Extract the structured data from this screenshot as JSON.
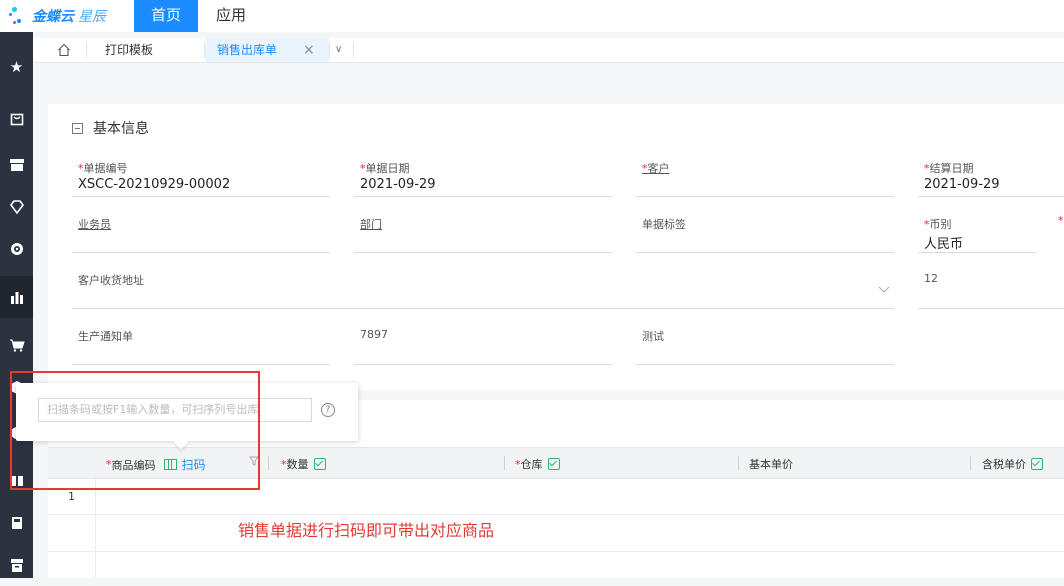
{
  "brand": {
    "name": "金蝶云",
    "suffix": "星辰"
  },
  "nav": {
    "home": "首页",
    "app": "应用"
  },
  "tabs": {
    "home_icon": "home-icon",
    "print": "打印模板",
    "active": "销售出库单",
    "close": "×",
    "more": "∨"
  },
  "section": {
    "title": "基本信息"
  },
  "fields": {
    "bill_no": {
      "label": "单据编号",
      "value": "XSCC-20210929-00002"
    },
    "bill_date": {
      "label": "单据日期",
      "value": "2021-09-29"
    },
    "customer": {
      "label": "客户",
      "value": ""
    },
    "settle_date": {
      "label": "结算日期",
      "value": "2021-09-29"
    },
    "salesman": {
      "label": "业务员"
    },
    "dept": {
      "label": "部门"
    },
    "tag": {
      "label": "单据标签"
    },
    "currency": {
      "label": "币别",
      "value": "人民币"
    },
    "address": {
      "label": "客户收货地址"
    },
    "num_12": "12",
    "notice": {
      "label": "生产通知单"
    },
    "val_7897": "7897",
    "test": "测试"
  },
  "grid": {
    "columns": {
      "product_code": "商品编码",
      "scan": "扫码",
      "qty": "数量",
      "warehouse": "仓库",
      "base_price": "基本单价",
      "tax_price": "含税单价"
    },
    "row_num": "1"
  },
  "scan_popup": {
    "placeholder": "扫描条码或按F1输入数量，可扫序列号出库",
    "help": "?"
  },
  "annotation": "销售单据进行扫码即可带出对应商品",
  "colors": {
    "accent": "#1a8cff",
    "sidebar": "#2b3340",
    "annotation": "#e53935",
    "check": "#2eb872"
  }
}
